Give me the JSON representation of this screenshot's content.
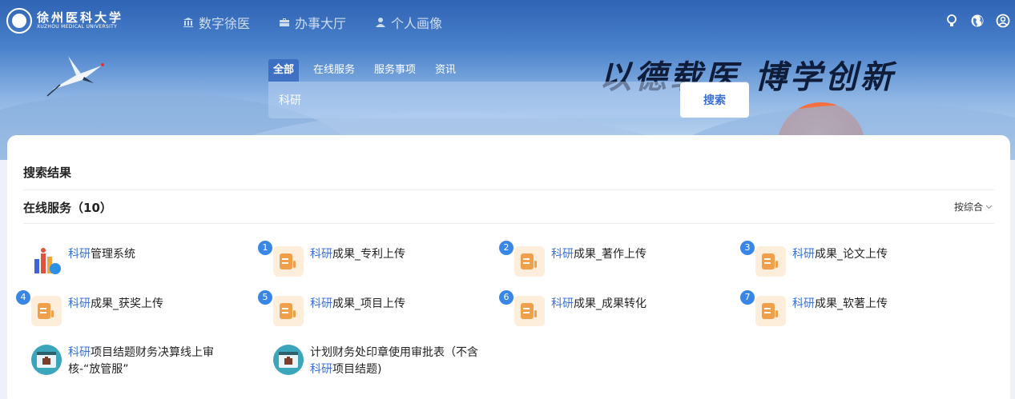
{
  "header": {
    "logo_cn": "徐州医科大学",
    "logo_en": "XUZHOU MEDICAL UNIVERSITY",
    "nav": [
      {
        "label": "数字徐医",
        "icon": "bank-icon"
      },
      {
        "label": "办事大厅",
        "icon": "briefcase-icon"
      },
      {
        "label": "个人画像",
        "icon": "user-icon"
      }
    ],
    "right_icons": [
      "lightbulb-icon",
      "globe-icon",
      "user-circle-icon"
    ]
  },
  "banner": {
    "slogan": "以德载医 博学创新"
  },
  "search": {
    "tabs": [
      "全部",
      "在线服务",
      "服务事项",
      "资讯"
    ],
    "active_tab": 0,
    "value": "科研",
    "button": "搜索"
  },
  "results": {
    "title": "搜索结果",
    "section_title": "在线服务（10）",
    "sort_label": "按综合",
    "items": [
      {
        "hl": "科研",
        "rest": "管理系统",
        "badge": "",
        "icon": "research-chart-icon"
      },
      {
        "hl": "科研",
        "rest": "成果_专利上传",
        "badge": "1",
        "icon": "document-icon"
      },
      {
        "hl": "科研",
        "rest": "成果_著作上传",
        "badge": "2",
        "icon": "document-icon"
      },
      {
        "hl": "科研",
        "rest": "成果_论文上传",
        "badge": "3",
        "icon": "document-icon"
      },
      {
        "hl": "科研",
        "rest": "成果_获奖上传",
        "badge": "4",
        "icon": "document-icon"
      },
      {
        "hl": "科研",
        "rest": "成果_项目上传",
        "badge": "5",
        "icon": "document-icon"
      },
      {
        "hl": "科研",
        "rest": "成果_成果转化",
        "badge": "6",
        "icon": "document-icon"
      },
      {
        "hl": "科研",
        "rest": "成果_软著上传",
        "badge": "7",
        "icon": "document-icon"
      },
      {
        "pre": "",
        "hl": "科研",
        "rest": "项目结题财务决算线上审核-“放管服”",
        "badge": "",
        "icon": "browser-window-icon"
      },
      {
        "pre": "计划财务处印章使用审批表（不含",
        "hl": "科研",
        "rest": "项目结题)",
        "badge": "",
        "icon": "browser-window-icon"
      }
    ]
  },
  "colors": {
    "accent": "#3a72d6",
    "badge": "#3a86e6",
    "doc_icon": "#f0a04b",
    "window_icon": "#3ba6bb"
  }
}
